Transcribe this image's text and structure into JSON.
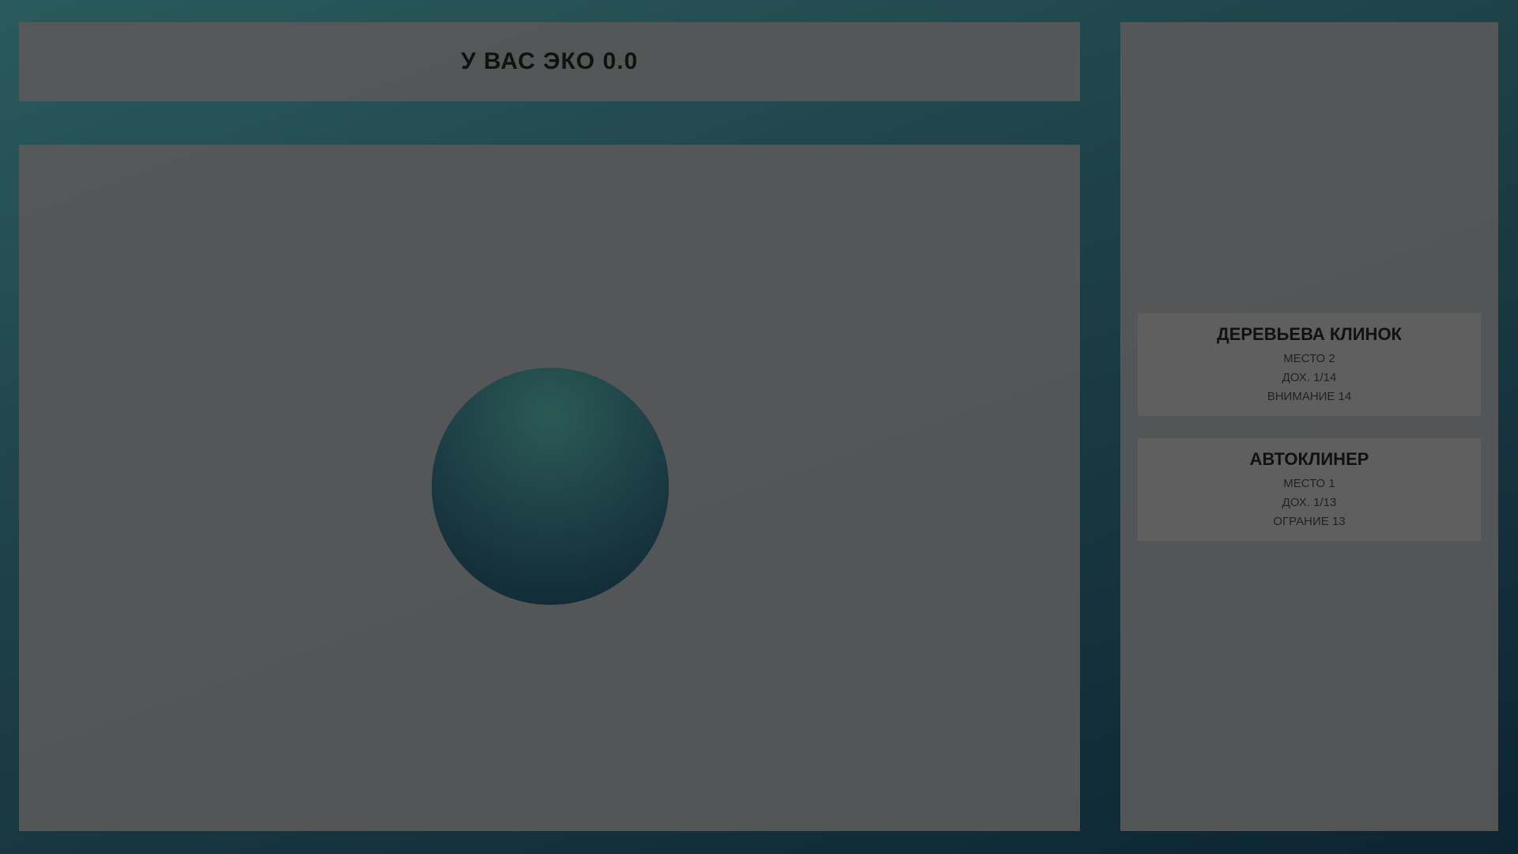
{
  "header": {
    "title": "У ВАС ЭКО 0.0"
  },
  "players": [
    {
      "name": "ДЕРЕВЬЕВА КЛИНОК",
      "stats": [
        "МЕСТО 2",
        "ДОХ. 1/14",
        "ВНИМАНИЕ 14"
      ]
    },
    {
      "name": "АВТОКЛИНЕР",
      "stats": [
        "МЕСТО 1",
        "ДОХ. 1/13",
        "ОГРАНИЕ 13"
      ]
    }
  ],
  "colors": {
    "background_top": "#2a5a5c",
    "background_bottom": "#0d2433",
    "panel": "#585858",
    "token": "#1b3b43"
  }
}
